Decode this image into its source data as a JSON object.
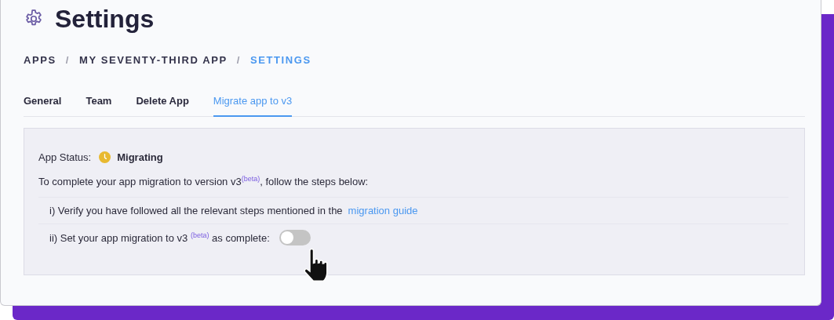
{
  "header": {
    "title": "Settings"
  },
  "breadcrumb": [
    {
      "kind": "crumb",
      "label": "APPS",
      "selected": false
    },
    {
      "kind": "separator",
      "label": "/"
    },
    {
      "kind": "crumb",
      "label": "MY SEVENTY-THIRD APP",
      "selected": false
    },
    {
      "kind": "separator",
      "label": "/"
    },
    {
      "kind": "crumb",
      "label": "SETTINGS",
      "selected": true
    }
  ],
  "tabs": [
    {
      "label": "General",
      "selected": false
    },
    {
      "label": "Team",
      "selected": false
    },
    {
      "label": "Delete App",
      "selected": false
    },
    {
      "label": "Migrate app to v3",
      "selected": true
    }
  ],
  "panel": {
    "status": {
      "label": "App Status:",
      "value": "Migrating",
      "color": "#e8b930"
    },
    "intro": "To complete your app migration to version v3$^{(beta)}$, follow the steps below:",
    "steps": [
      {
        "kind": "link",
        "text": "i) Verify you have followed all the relevant steps mentioned in the",
        "link": "migration guide"
      },
      {
        "kind": "toggle",
        "text": "ii) Set your app migration to v3 $^{(beta)}$ as complete:",
        "on": false
      }
    ]
  }
}
